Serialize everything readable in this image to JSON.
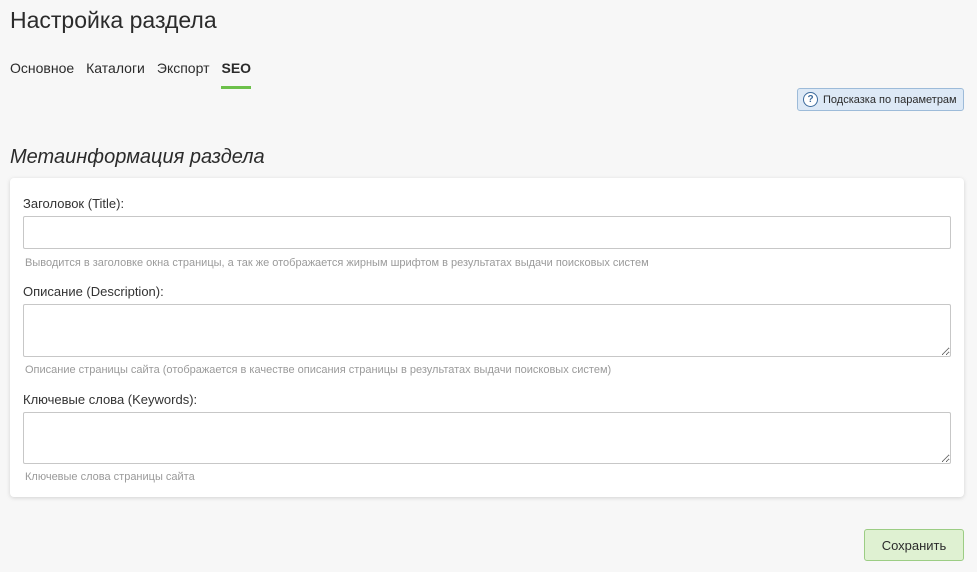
{
  "header": {
    "title": "Настройка раздела"
  },
  "tabs": [
    {
      "label": "Основное",
      "active": false
    },
    {
      "label": "Каталоги",
      "active": false
    },
    {
      "label": "Экспорт",
      "active": false
    },
    {
      "label": "SEO",
      "active": true
    }
  ],
  "hint": {
    "icon": "help-circle-icon",
    "label": "Подсказка по параметрам"
  },
  "section": {
    "title": "Метаинформация раздела"
  },
  "fields": {
    "title": {
      "label": "Заголовок (Title):",
      "value": "",
      "help": "Выводится в заголовке окна страницы, а так же отображается жирным шрифтом в результатах выдачи поисковых систем"
    },
    "description": {
      "label": "Описание (Description):",
      "value": "",
      "help": "Описание страницы сайта (отображается в качестве описания страницы в результатах выдачи поисковых систем)"
    },
    "keywords": {
      "label": "Ключевые слова (Keywords):",
      "value": "",
      "help": "Ключевые слова страницы сайта"
    }
  },
  "actions": {
    "save_label": "Сохранить"
  },
  "colors": {
    "active_tab_underline": "#6cc04a",
    "save_button_bg": "#dff1d2",
    "hint_button_bg": "#dde9f6"
  }
}
